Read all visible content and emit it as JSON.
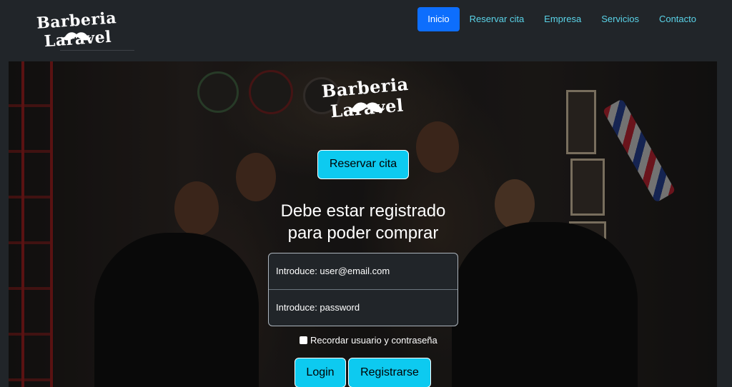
{
  "navbar": {
    "brand": "Barberia Laravel",
    "items": [
      {
        "label": "Inicio",
        "active": true
      },
      {
        "label": "Reservar cita",
        "active": false
      },
      {
        "label": "Empresa",
        "active": false
      },
      {
        "label": "Servicios",
        "active": false
      },
      {
        "label": "Contacto",
        "active": false
      }
    ]
  },
  "hero": {
    "logo": "Barberia Laravel",
    "reservar_button": "Reservar cita",
    "message_line1": "Debe estar registrado",
    "message_line2": "para poder comprar",
    "email_placeholder": "Introduce: user@email.com",
    "password_placeholder": "Introduce: password",
    "remember_label": "Recordar usuario y contraseña",
    "login_button": "Login",
    "register_button": "Registrarse"
  },
  "colors": {
    "background": "#212529",
    "nav_link": "#5ad3e8",
    "active_nav": "#0d6efd",
    "button_cyan": "#0dcaf0"
  },
  "icons": [
    "mustache-icon"
  ]
}
